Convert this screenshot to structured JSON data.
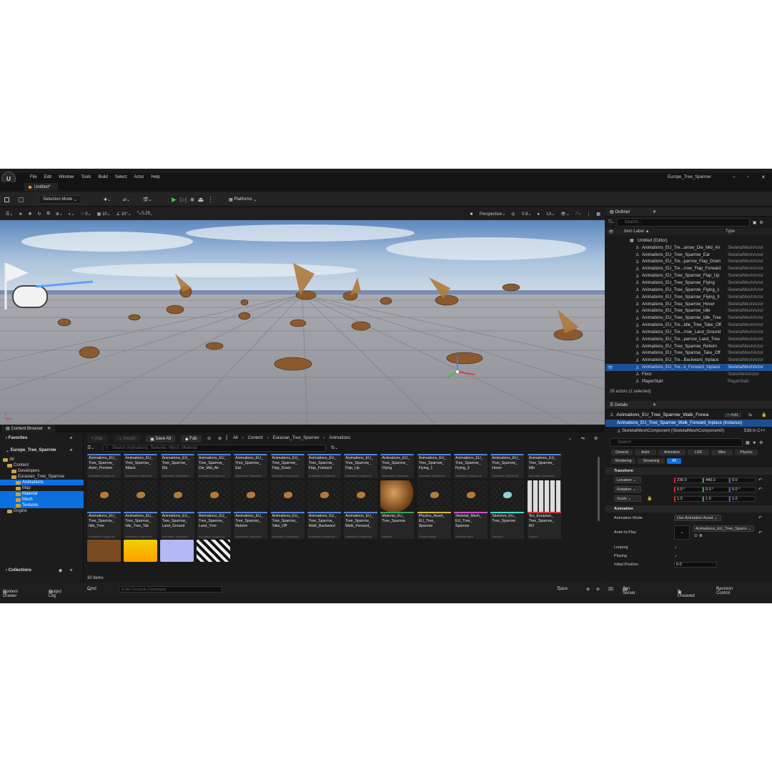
{
  "window": {
    "logo_text": "U",
    "title": "Europe_Tree_Sparrow",
    "tab_title": "Untitled",
    "menu": [
      "File",
      "Edit",
      "Window",
      "Tools",
      "Build",
      "Select",
      "Actor",
      "Help"
    ],
    "minimize": "–",
    "maximize": "▫",
    "close": "✕"
  },
  "toolbar": {
    "selection_mode": "Selection Mode",
    "platforms": "Platforms"
  },
  "viewport": {
    "snap_translate": "10",
    "snap_rotate": "10°",
    "snap_scale": "0.25",
    "grid_count": "0",
    "perspective": "Perspective",
    "fov": "0.9",
    "lit": "Lit"
  },
  "outliner": {
    "title": "Outliner",
    "search_placeholder": "Search...",
    "col_label": "Item Label ▲",
    "col_type": "Type",
    "rows": [
      {
        "label": "Untitled (Editor)",
        "type": "",
        "indent": 0
      },
      {
        "label": "Animations_EU_Tre...arrow_Die_Mid_Air",
        "type": "SkeletalMeshActor",
        "indent": 1
      },
      {
        "label": "Animations_EU_Tree_Sparrow_Eat",
        "type": "SkeletalMeshActor",
        "indent": 1
      },
      {
        "label": "Animations_EU_Tre...parrow_Flap_Down",
        "type": "SkeletalMeshActor",
        "indent": 1
      },
      {
        "label": "Animations_EU_Tre...rrow_Flap_Forward",
        "type": "SkeletalMeshActor",
        "indent": 1
      },
      {
        "label": "Animations_EU_Tree_Sparrow_Flap_Up",
        "type": "SkeletalMeshActor",
        "indent": 1
      },
      {
        "label": "Animations_EU_Tree_Sparrow_Flying",
        "type": "SkeletalMeshActor",
        "indent": 1
      },
      {
        "label": "Animations_EU_Tree_Sparrow_Flying_1",
        "type": "SkeletalMeshActor",
        "indent": 1
      },
      {
        "label": "Animations_EU_Tree_Sparrow_Flying_3",
        "type": "SkeletalMeshActor",
        "indent": 1
      },
      {
        "label": "Animations_EU_Tree_Sparrow_Hover",
        "type": "SkeletalMeshActor",
        "indent": 1
      },
      {
        "label": "Animations_EU_Tree_Sparrow_Idle",
        "type": "SkeletalMeshActor",
        "indent": 1
      },
      {
        "label": "Animations_EU_Tree_Sparrow_Idle_Tree",
        "type": "SkeletalMeshActor",
        "indent": 1
      },
      {
        "label": "Animations_EU_Tre...Idle_Tree_Take_Off",
        "type": "SkeletalMeshActor",
        "indent": 1
      },
      {
        "label": "Animations_EU_Tre...rrow_Land_Ground",
        "type": "SkeletalMeshActor",
        "indent": 1
      },
      {
        "label": "Animations_EU_Tre...parrow_Land_Tree",
        "type": "SkeletalMeshActor",
        "indent": 1
      },
      {
        "label": "Animations_EU_Tree_Sparrow_Reborn",
        "type": "SkeletalMeshActor",
        "indent": 1
      },
      {
        "label": "Animations_EU_Tree_Sparrow_Take_Off",
        "type": "SkeletalMeshActor",
        "indent": 1
      },
      {
        "label": "Animations_EU_Tre...Backward_Inplace",
        "type": "SkeletalMeshActor",
        "indent": 1
      },
      {
        "label": "Animations_EU_Tre...k_Forward_Inplace",
        "type": "SkeletalMeshActor",
        "indent": 1,
        "selected": true
      },
      {
        "label": "Floor",
        "type": "StaticMeshActor",
        "indent": 1
      },
      {
        "label": "PlayerStart",
        "type": "PlayerStart",
        "indent": 1
      }
    ],
    "status": "29 actors (1 selected)"
  },
  "details": {
    "title": "Details",
    "actor_name": "Animations_EU_Tree_Sparrow_Walk_Forwa",
    "add_label": "+ Add",
    "instance_row": "Animations_EU_Tree_Sparrow_Walk_Forward_Inplace (Instance)",
    "component_row": "SkeletalMeshComponent (SkeletalMeshComponent0)",
    "edit_cpp": "Edit in C++",
    "search_placeholder": "Search",
    "filters_row1": [
      "General",
      "Actor",
      "Animation",
      "LOD",
      "Misc",
      "Physics"
    ],
    "filters_row2": [
      "Rendering",
      "Streaming",
      "All"
    ],
    "transform_section": "Transform",
    "location_label": "Location",
    "rotation_label": "Rotation",
    "scale_label": "Scale",
    "location": [
      "230.0",
      "440.0",
      "0.0"
    ],
    "rotation": [
      "0.0 °",
      "0.0 °",
      "0.0 °"
    ],
    "scale": [
      "1.0",
      "1.0",
      "1.0"
    ],
    "animation_section": "Animation",
    "animation_mode_label": "Animation Mode",
    "animation_mode_value": "Use Animation Asset",
    "anim_to_play_label": "Anim to Play",
    "anim_to_play_value": "Animations_EU_Tree_Sparro",
    "looping_label": "Looping",
    "playing_label": "Playing",
    "initial_position_label": "Initial Position",
    "initial_position_value": "0.0"
  },
  "content_browser": {
    "tab": "Content Browser",
    "favorites": "Favorites",
    "project": "Europe_Tree_Sparrow",
    "collections": "Collections",
    "tree": [
      {
        "label": "All",
        "level": 0
      },
      {
        "label": "Content",
        "level": 1
      },
      {
        "label": "Developers",
        "level": 2
      },
      {
        "label": "Eurasian_Tree_Sparrow",
        "level": 2
      },
      {
        "label": "Animations",
        "level": 3,
        "selected": true
      },
      {
        "label": "Map",
        "level": 3
      },
      {
        "label": "Material",
        "level": 3,
        "selected": true
      },
      {
        "label": "Mesh",
        "level": 3,
        "selected": true
      },
      {
        "label": "Textures",
        "level": 3,
        "selected": true
      },
      {
        "label": "Engine",
        "level": 1
      }
    ],
    "add_btn": "+ Add",
    "import_btn": "Import",
    "save_all_btn": "Save All",
    "fab_btn": "Fab",
    "breadcrumb": [
      "All",
      "Content",
      "Eurasian_Tree_Sparrow",
      "Animations"
    ],
    "search_placeholder": "Search Animations, Textures, Mesh, Material",
    "row1": [
      {
        "name": "Animations_EU_\nTree_Sparrow_\nAnim_Preview",
        "type": "Animation Sequence"
      },
      {
        "name": "Animations_EU_\nTree_Sparrow_\nAttack",
        "type": "Animation Sequence"
      },
      {
        "name": "Animations_EU_\nTree_Sparrow_\nDie",
        "type": "Animation Sequence"
      },
      {
        "name": "Animations_EU_\nTree_Sparrow_\nDie_Mid_Air",
        "type": "Animation Sequence"
      },
      {
        "name": "Animations_EU_\nTree_Sparrow_\nEat",
        "type": "Animation Sequence"
      },
      {
        "name": "Animations_EU_\nTree_Sparrow_\nFlap_Down",
        "type": "Animation Sequence"
      },
      {
        "name": "Animations_EU_\nTree_Sparrow_\nFlap_Forward",
        "type": "Animation Sequence"
      },
      {
        "name": "Animations_EU_\nTree_Sparrow_\nFlap_Up",
        "type": "Animation Sequence"
      },
      {
        "name": "Animations_EU_\nTree_Sparrow_\nFlying",
        "type": "Animation Sequence"
      },
      {
        "name": "Animations_EU_\nTree_Sparrow_\nFlying_1",
        "type": "Animation Sequence"
      },
      {
        "name": "Animations_EU_\nTree_Sparrow_\nFlying_3",
        "type": "Animation Sequence"
      },
      {
        "name": "Animations_EU_\nTree_Sparrow_\nHover",
        "type": "Animation Sequence"
      },
      {
        "name": "Animations_EU_\nTree_Sparrow_\nIdle",
        "type": "Animation Sequence"
      }
    ],
    "row2": [
      {
        "name": "Animations_EU_\nTree_Sparrow_\nIdle_Tree",
        "type": "Animation Sequence",
        "thumb": "bird"
      },
      {
        "name": "Animations_EU_\nTree_Sparrow_\nIdle_Tree_Tak",
        "type": "Animation Sequence",
        "thumb": "bird"
      },
      {
        "name": "Animations_EU_\nTree_Sparrow_\nLand_Ground",
        "type": "Animation Sequence",
        "thumb": "bird"
      },
      {
        "name": "Animations_EU_\nTree_Sparrow_\nLand_Tree",
        "type": "Animation Sequence",
        "thumb": "bird"
      },
      {
        "name": "Animations_EU_\nTree_Sparrow_\nReborn",
        "type": "Animation Sequence",
        "thumb": "bird"
      },
      {
        "name": "Animations_EU_\nTree_Sparrow_\nTake_Off",
        "type": "Animation Sequence",
        "thumb": "bird"
      },
      {
        "name": "Animations_EU_\nTree_Sparrow_\nWalk_Backward",
        "type": "Animation Sequence",
        "thumb": "bird"
      },
      {
        "name": "Animations_EU_\nTree_Sparrow_\nWalk_Forward_",
        "type": "Animation Sequence",
        "thumb": "bird"
      },
      {
        "name": "Material_EU_\nTree_Sparrow",
        "type": "Material",
        "thumb": "sphere"
      },
      {
        "name": "Physics_Asset_\nEU_Tree_\nSparrow",
        "type": "Physics Asset",
        "thumb": "bird"
      },
      {
        "name": "Skeletal_Mesh_\nEU_Tree_\nSparrow",
        "type": "Skeletal Mesh",
        "thumb": "bird"
      },
      {
        "name": "Skeleton_EU_\nTree_Sparrow",
        "type": "Skeleton",
        "thumb": "skeleton"
      },
      {
        "name": "Tex_Eurasian_\nTree_Sparrow_\nAO",
        "type": "Texture",
        "thumb": "ao"
      }
    ],
    "item_count": "30 items"
  },
  "statusbar": {
    "content_drawer": "Content Drawer",
    "output_log": "Output Log",
    "cmd": "Cmd",
    "console_placeholder": "Enter Console Command",
    "trace": "Trace",
    "zen_server": "Zen Server",
    "unsaved": "5 Unsaved",
    "revision_control": "Revision Control"
  },
  "colors": {
    "accent": "#0b6fe0",
    "selection": "#1f4f93",
    "frame_green": "#15a837"
  }
}
